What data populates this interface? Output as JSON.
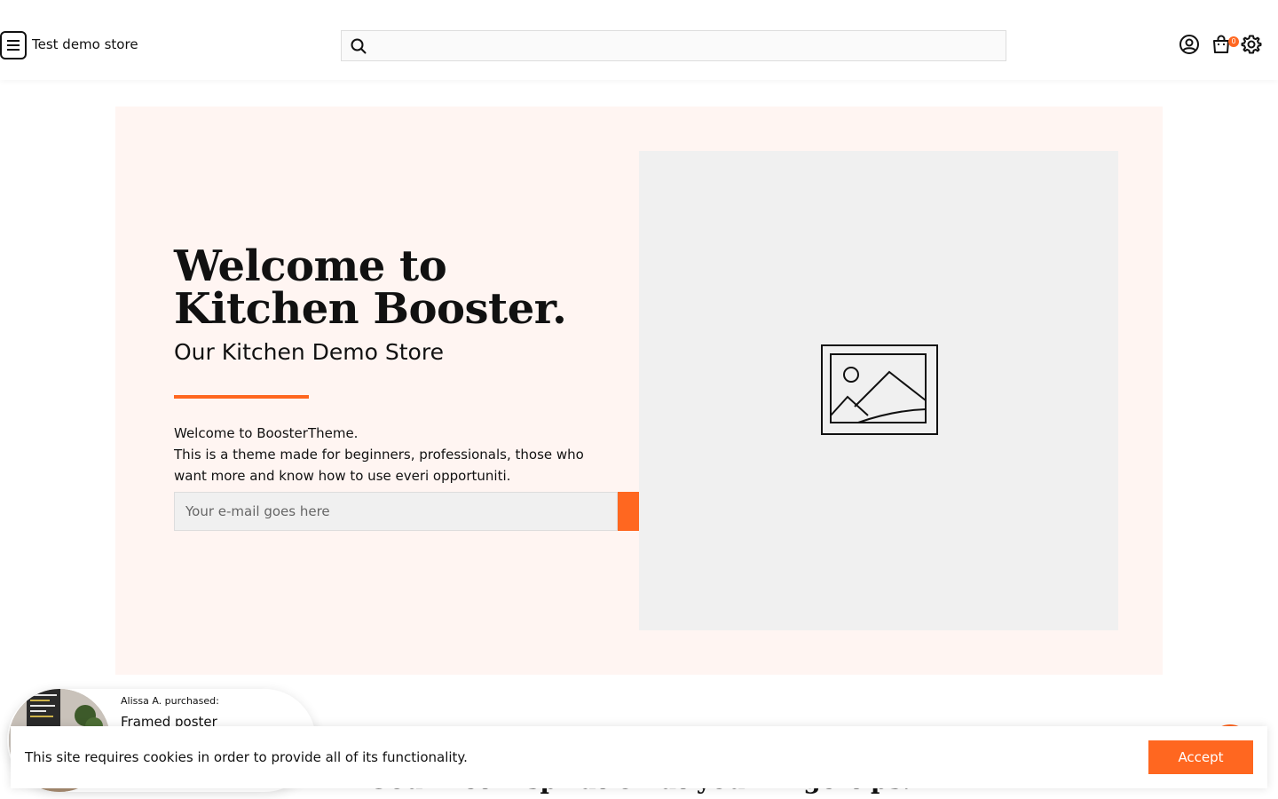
{
  "header": {
    "store_name": "Test demo store",
    "search_placeholder": "",
    "cart_count": "0",
    "icons": [
      "menu-icon",
      "search-icon",
      "account-icon",
      "cart-icon",
      "settings-icon"
    ]
  },
  "hero": {
    "title": "Welcome to Kitchen Booster.",
    "subtitle": "Our Kitchen Demo Store",
    "text_line1": "Welcome to BoosterTheme.",
    "text_line2": "This is a theme made for beginners, professionals, those who",
    "text_line3": "want more and know how to use everi opportuniti.",
    "email_placeholder": "Your e-mail goes here",
    "image_icon": "image-placeholder-icon"
  },
  "section": {
    "heading": "Gourmet inspiration at your fingertips."
  },
  "purchase_popup": {
    "label": "Alissa A. purchased:",
    "product": "Framed poster"
  },
  "cookie": {
    "text": "This site requires cookies in order to provide all of its functionality.",
    "accept_label": "Accept"
  },
  "colors": {
    "accent": "#ff6720",
    "hero_bg": "#fff5f2",
    "image_bg": "#f0f0f0"
  }
}
